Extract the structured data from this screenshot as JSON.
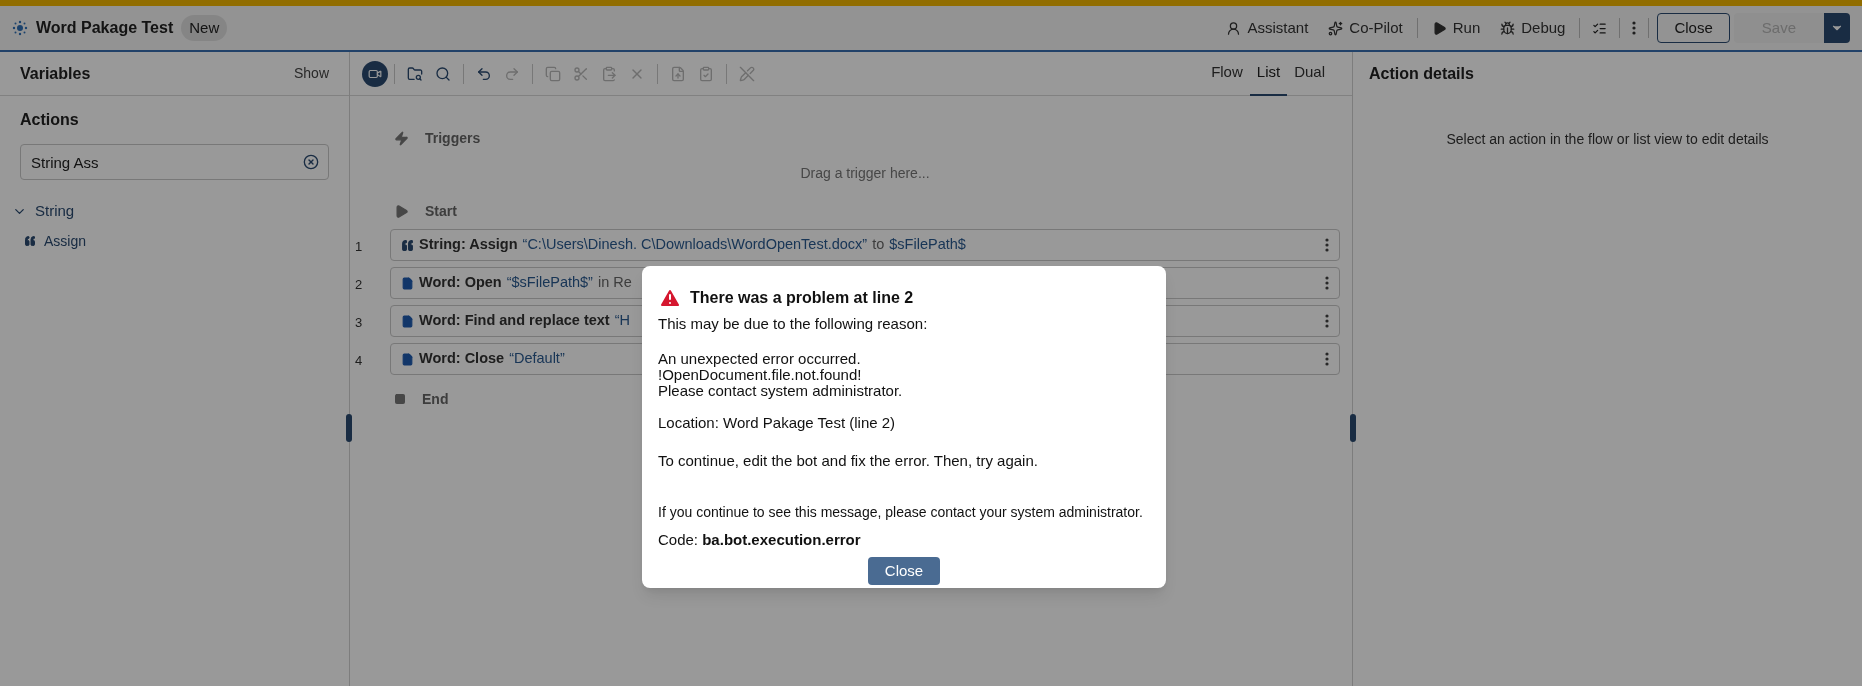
{
  "header": {
    "title": "Word Pakage Test",
    "badge": "New",
    "actions": [
      {
        "kind": "assistant",
        "label": "Assistant"
      },
      {
        "kind": "copilot",
        "label": "Co-Pilot"
      },
      {
        "kind": "run",
        "label": "Run"
      },
      {
        "kind": "debug",
        "label": "Debug"
      }
    ],
    "close_button": "Close",
    "save_button": {
      "label": "Save",
      "disabled": true
    }
  },
  "left_panel": {
    "variables_title": "Variables",
    "show_link": "Show",
    "actions_title": "Actions",
    "search_value": "String Ass",
    "tree": [
      {
        "label": "String",
        "expanded": true,
        "children": [
          {
            "label": "Assign"
          }
        ]
      }
    ]
  },
  "toolbar": [
    {
      "kind": "record",
      "disabled": false
    },
    {
      "kind": "sep"
    },
    {
      "kind": "find-in-folder",
      "disabled": false
    },
    {
      "kind": "search",
      "disabled": false
    },
    {
      "kind": "sep"
    },
    {
      "kind": "undo",
      "disabled": false
    },
    {
      "kind": "redo",
      "disabled": true
    },
    {
      "kind": "sep"
    },
    {
      "kind": "copy",
      "disabled": true
    },
    {
      "kind": "cut",
      "disabled": true
    },
    {
      "kind": "paste",
      "disabled": true
    },
    {
      "kind": "delete",
      "disabled": true
    },
    {
      "kind": "sep"
    },
    {
      "kind": "export",
      "disabled": true
    },
    {
      "kind": "import",
      "disabled": true
    },
    {
      "kind": "sep"
    },
    {
      "kind": "disable",
      "disabled": true
    }
  ],
  "view_tabs": [
    {
      "label": "Flow",
      "selected": false
    },
    {
      "label": "List",
      "selected": true
    },
    {
      "label": "Dual",
      "selected": false
    }
  ],
  "flow": {
    "triggers_label": "Triggers",
    "drop_hint": "Drag a trigger here...",
    "start_label": "Start",
    "end_label": "End",
    "rows": [
      {
        "number": "1",
        "kind": "string",
        "parts": [
          {
            "kind": "label",
            "text": "String: Assign"
          },
          {
            "kind": "value",
            "text": "“C:\\Users\\Dinesh. C\\Downloads\\WordOpenTest.docx”"
          },
          {
            "kind": "plain",
            "text": "to"
          },
          {
            "kind": "value",
            "text": "$sFilePath$"
          }
        ]
      },
      {
        "number": "2",
        "kind": "word",
        "parts": [
          {
            "kind": "label",
            "text": "Word: Open"
          },
          {
            "kind": "value",
            "text": "“$sFilePath$”"
          },
          {
            "kind": "plain",
            "text": "in Re"
          }
        ]
      },
      {
        "number": "3",
        "kind": "word",
        "parts": [
          {
            "kind": "label",
            "text": "Word: Find and replace text"
          },
          {
            "kind": "value",
            "text": "“H"
          }
        ]
      },
      {
        "number": "4",
        "kind": "word",
        "parts": [
          {
            "kind": "label",
            "text": "Word: Close"
          },
          {
            "kind": "value",
            "text": "“Default”"
          }
        ]
      }
    ]
  },
  "right_panel": {
    "title": "Action details",
    "hint": "Select an action in the flow or list view to edit details"
  },
  "dialog": {
    "title": "There was a problem at line 2",
    "intro": "This may be due to the following reason:",
    "error_lines": [
      "An unexpected error occurred.",
      "!OpenDocument.file.not.found!",
      "Please contact system administrator."
    ],
    "location": "Location: Word Pakage Test (line 2)",
    "advice": "To continue, edit the bot and fix the error. Then, try again.",
    "persist": "If you continue to see this message, please contact your system administrator.",
    "code": "Code: **ba.bot.execution.error**",
    "button": "Close"
  }
}
